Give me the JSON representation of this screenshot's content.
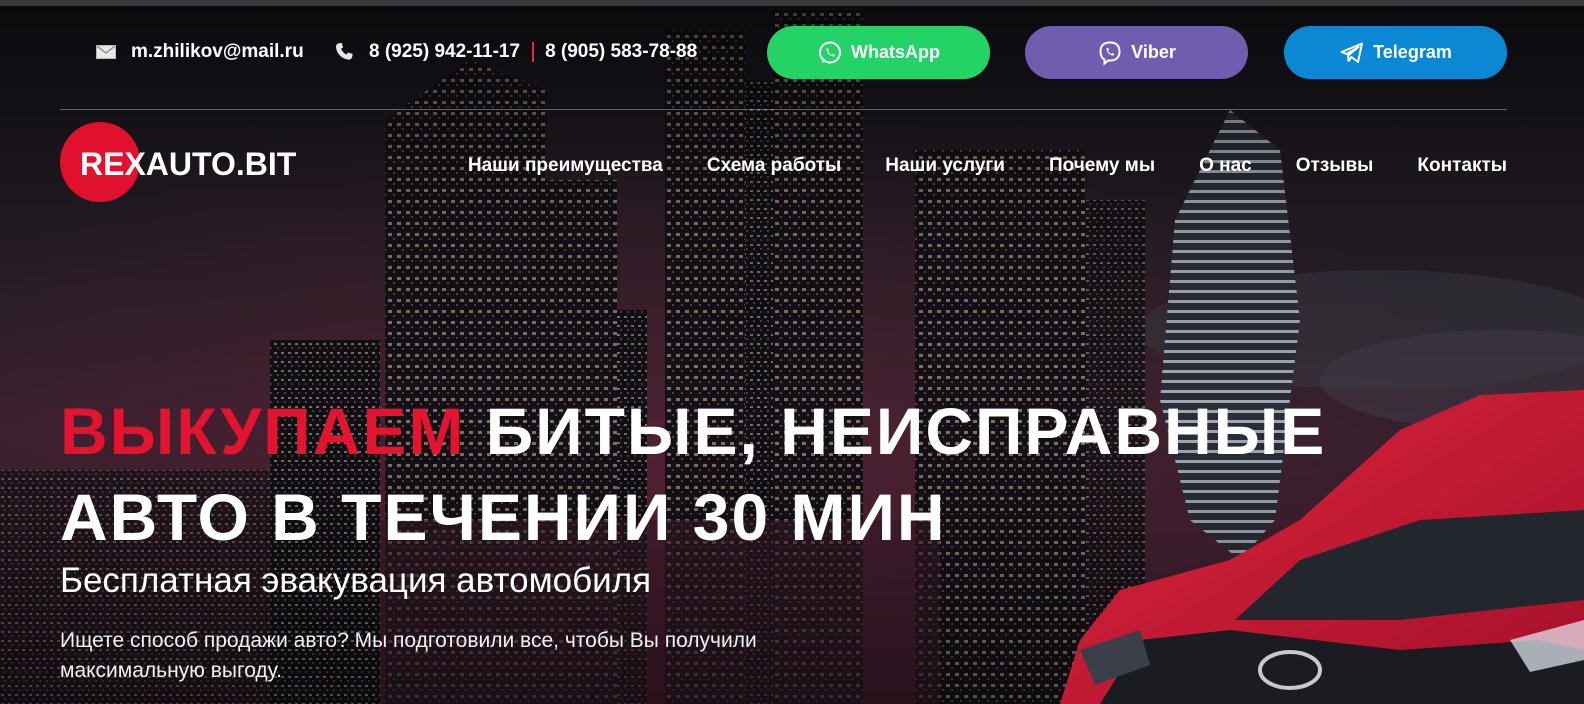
{
  "contacts": {
    "email": "m.zhilikov@mail.ru",
    "phone_1": "8 (925) 942-11-17",
    "phone_2": "8 (905) 583-78-88"
  },
  "messengers": {
    "whatsapp": "WhatsApp",
    "viber": "Viber",
    "telegram": "Telegram"
  },
  "logo": {
    "text": "REXAUTO.BIT"
  },
  "nav": {
    "items": [
      "Наши преимущества",
      "Схема работы",
      "Наши услуги",
      "Почему мы",
      "О нас",
      "Отзывы",
      "Контакты"
    ]
  },
  "hero": {
    "headline_accent": "ВЫКУПАЕМ",
    "headline_line1_rest": " БИТЫЕ, НЕИСПРАВНЫЕ",
    "headline_line2": "АВТО В ТЕЧЕНИИ 30 МИН",
    "subtitle": "Бесплатная эвакувация автомобиля",
    "description": "Ищете способ продажи авто? Мы подготовили все, чтобы Вы получили максимальную выгоду."
  },
  "colors": {
    "accent_red": "#e4132f",
    "whatsapp_green": "#24d366",
    "viber_purple": "#6f5daf",
    "telegram_blue": "#0a88d4"
  }
}
